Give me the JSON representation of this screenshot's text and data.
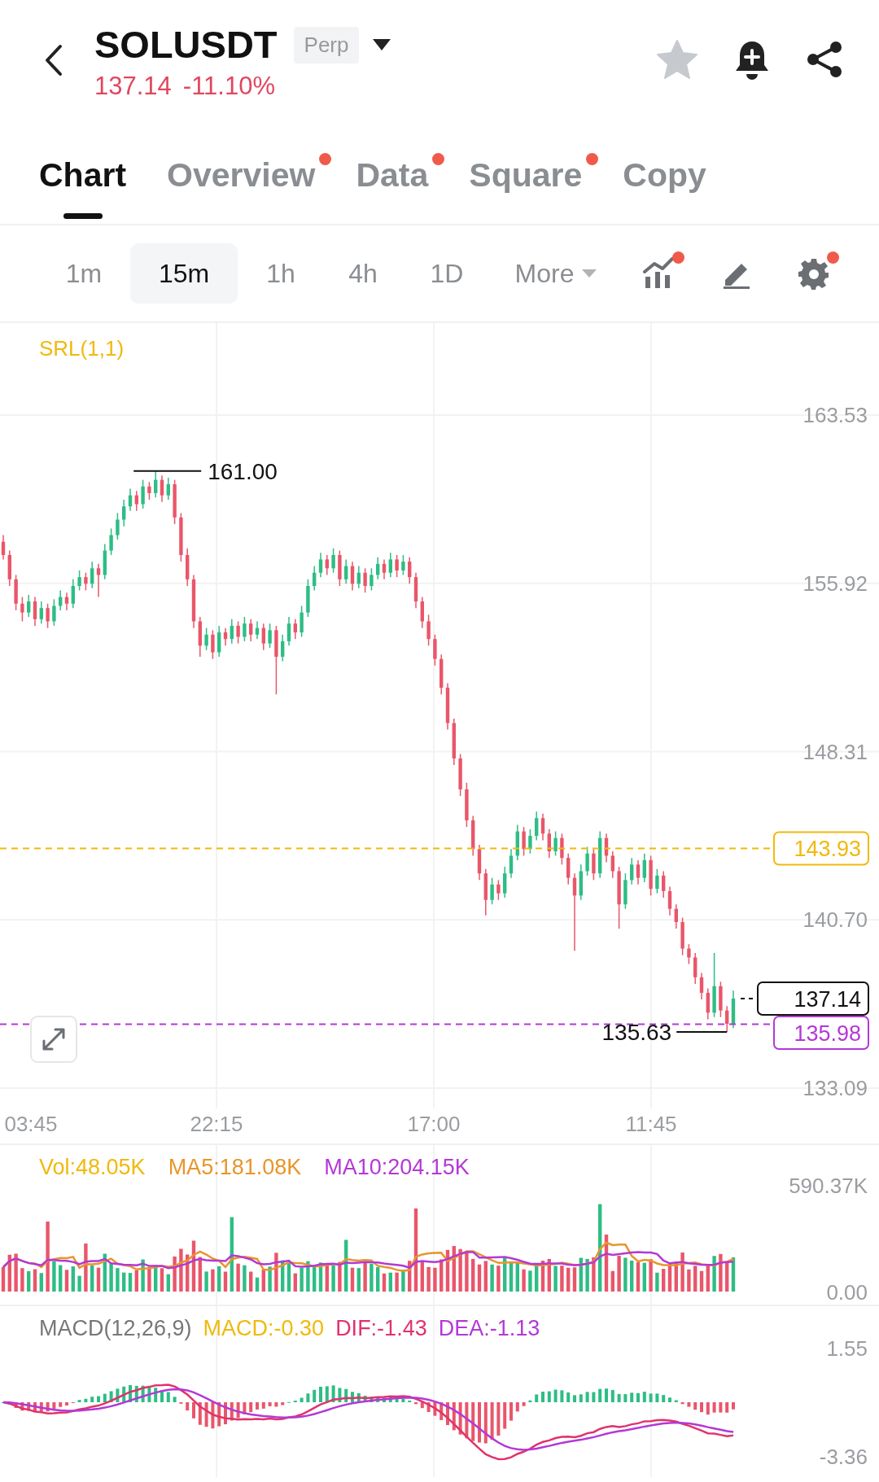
{
  "header": {
    "symbol": "SOLUSDT",
    "contract_badge": "Perp",
    "price": "137.14",
    "change": "-11.10%"
  },
  "tabs": [
    {
      "label": "Chart",
      "selected": true,
      "dot": false
    },
    {
      "label": "Overview",
      "selected": false,
      "dot": true
    },
    {
      "label": "Data",
      "selected": false,
      "dot": true
    },
    {
      "label": "Square",
      "selected": false,
      "dot": true
    },
    {
      "label": "Copy",
      "selected": false,
      "dot": false
    }
  ],
  "intervals": [
    {
      "label": "1m",
      "selected": false
    },
    {
      "label": "15m",
      "selected": true
    },
    {
      "label": "1h",
      "selected": false
    },
    {
      "label": "4h",
      "selected": false
    },
    {
      "label": "1D",
      "selected": false
    }
  ],
  "more": "More",
  "tools": [
    {
      "kind": "indicator",
      "dot": true
    },
    {
      "kind": "draw",
      "dot": false
    },
    {
      "kind": "settings",
      "dot": true
    }
  ],
  "main_chart": {
    "indicator": "SRL(1,1)",
    "high_label": "161.00",
    "low_label": "135.63",
    "last_price": "137.14",
    "time_axis": [
      "03:45",
      "22:15",
      "17:00",
      "11:45"
    ],
    "chart_data": {
      "type": "candlestick",
      "grid": true,
      "ref_lines": [
        {
          "axis": "y",
          "value": 143.93,
          "label": "143.93",
          "color": "#f0b90b"
        },
        {
          "axis": "y",
          "value": 135.98,
          "label": "135.98",
          "color": "#b438d6"
        }
      ],
      "yticks": [
        {
          "value": 163.53,
          "label": "163.53"
        },
        {
          "value": 155.92,
          "label": "155.92"
        },
        {
          "value": 148.31,
          "label": "148.31"
        },
        {
          "value": 140.7,
          "label": "140.70"
        },
        {
          "value": 133.09,
          "label": "133.09"
        }
      ],
      "ylim": [
        133.09,
        163.53
      ],
      "ohlc": [
        [
          157.8,
          158.1,
          157.0,
          157.2
        ],
        [
          157.2,
          157.4,
          155.8,
          156.1
        ],
        [
          156.1,
          156.3,
          154.7,
          155.0
        ],
        [
          155.0,
          155.3,
          154.2,
          154.6
        ],
        [
          154.6,
          155.4,
          154.4,
          155.1
        ],
        [
          155.1,
          155.3,
          154.0,
          154.3
        ],
        [
          154.3,
          155.1,
          154.1,
          154.8
        ],
        [
          154.8,
          155.0,
          153.9,
          154.2
        ],
        [
          154.2,
          155.2,
          154.0,
          154.9
        ],
        [
          154.9,
          155.6,
          154.7,
          155.3
        ],
        [
          155.3,
          155.5,
          154.7,
          155.0
        ],
        [
          155.0,
          156.1,
          154.8,
          155.8
        ],
        [
          155.8,
          156.5,
          155.6,
          156.2
        ],
        [
          156.2,
          156.4,
          155.6,
          155.9
        ],
        [
          155.9,
          156.9,
          155.7,
          156.6
        ],
        [
          156.6,
          156.8,
          155.3,
          156.3
        ],
        [
          156.3,
          157.7,
          156.1,
          157.4
        ],
        [
          157.4,
          158.4,
          157.2,
          158.1
        ],
        [
          158.1,
          159.1,
          157.9,
          158.8
        ],
        [
          158.8,
          159.7,
          158.5,
          159.4
        ],
        [
          159.4,
          160.2,
          159.2,
          159.9
        ],
        [
          159.9,
          160.1,
          159.2,
          159.5
        ],
        [
          159.5,
          160.6,
          159.3,
          160.3
        ],
        [
          160.3,
          160.5,
          159.7,
          160.0
        ],
        [
          160.0,
          161.0,
          159.8,
          160.6
        ],
        [
          160.6,
          160.8,
          159.6,
          159.9
        ],
        [
          159.9,
          160.7,
          159.7,
          160.4
        ],
        [
          160.4,
          160.6,
          158.6,
          158.9
        ],
        [
          158.9,
          159.1,
          156.9,
          157.2
        ],
        [
          157.2,
          157.5,
          155.8,
          156.1
        ],
        [
          156.1,
          156.3,
          153.9,
          154.2
        ],
        [
          154.2,
          154.4,
          152.6,
          153.1
        ],
        [
          153.1,
          153.9,
          152.9,
          153.6
        ],
        [
          153.6,
          153.8,
          152.5,
          152.8
        ],
        [
          152.8,
          154.0,
          152.6,
          153.7
        ],
        [
          153.7,
          153.9,
          153.1,
          153.4
        ],
        [
          153.4,
          154.3,
          153.2,
          154.0
        ],
        [
          154.0,
          154.2,
          153.2,
          153.5
        ],
        [
          153.5,
          154.4,
          153.3,
          154.1
        ],
        [
          154.1,
          154.3,
          153.3,
          153.6
        ],
        [
          153.6,
          154.2,
          153.4,
          153.9
        ],
        [
          153.9,
          154.1,
          152.9,
          153.2
        ],
        [
          153.2,
          154.1,
          153.0,
          153.8
        ],
        [
          153.8,
          154.0,
          150.9,
          152.6
        ],
        [
          152.6,
          153.6,
          152.4,
          153.3
        ],
        [
          153.3,
          154.4,
          153.1,
          154.1
        ],
        [
          154.1,
          154.3,
          153.4,
          153.7
        ],
        [
          153.7,
          154.9,
          153.5,
          154.6
        ],
        [
          154.6,
          156.1,
          154.4,
          155.8
        ],
        [
          155.8,
          156.7,
          155.6,
          156.4
        ],
        [
          156.4,
          157.3,
          156.2,
          157.0
        ],
        [
          157.0,
          157.2,
          156.3,
          156.6
        ],
        [
          156.6,
          157.5,
          156.4,
          157.2
        ],
        [
          157.2,
          157.4,
          155.8,
          156.1
        ],
        [
          156.1,
          157.0,
          155.9,
          156.7
        ],
        [
          156.7,
          156.9,
          155.6,
          155.9
        ],
        [
          155.9,
          156.7,
          155.7,
          156.4
        ],
        [
          156.4,
          156.6,
          155.5,
          155.8
        ],
        [
          155.8,
          156.6,
          155.6,
          156.3
        ],
        [
          156.3,
          157.1,
          156.1,
          156.8
        ],
        [
          156.8,
          157.0,
          156.1,
          156.4
        ],
        [
          156.4,
          157.3,
          156.2,
          157.0
        ],
        [
          157.0,
          157.2,
          156.2,
          156.5
        ],
        [
          156.5,
          157.2,
          156.3,
          156.9
        ],
        [
          156.9,
          157.1,
          155.9,
          156.2
        ],
        [
          156.2,
          156.4,
          154.8,
          155.1
        ],
        [
          155.1,
          155.3,
          153.9,
          154.2
        ],
        [
          154.2,
          154.5,
          153.1,
          153.4
        ],
        [
          153.4,
          153.6,
          152.2,
          152.5
        ],
        [
          152.5,
          152.7,
          150.9,
          151.2
        ],
        [
          151.2,
          151.4,
          149.3,
          149.6
        ],
        [
          149.6,
          149.8,
          147.7,
          148.0
        ],
        [
          148.0,
          148.2,
          146.3,
          146.6
        ],
        [
          146.6,
          146.9,
          144.9,
          145.2
        ],
        [
          145.2,
          145.4,
          143.6,
          143.9
        ],
        [
          143.9,
          144.1,
          142.5,
          142.8
        ],
        [
          142.8,
          143.0,
          140.9,
          141.6
        ],
        [
          141.6,
          142.6,
          141.4,
          142.3
        ],
        [
          142.3,
          142.5,
          141.6,
          141.9
        ],
        [
          141.9,
          143.1,
          141.7,
          142.8
        ],
        [
          142.8,
          143.9,
          142.6,
          143.6
        ],
        [
          143.6,
          145.0,
          143.4,
          144.7
        ],
        [
          144.7,
          144.9,
          143.6,
          143.9
        ],
        [
          143.9,
          144.8,
          143.7,
          144.5
        ],
        [
          144.5,
          145.6,
          144.3,
          145.3
        ],
        [
          145.3,
          145.5,
          144.3,
          144.6
        ],
        [
          144.6,
          144.8,
          143.5,
          143.8
        ],
        [
          143.8,
          144.7,
          143.6,
          144.4
        ],
        [
          144.4,
          144.6,
          143.2,
          143.5
        ],
        [
          143.5,
          143.7,
          142.3,
          142.6
        ],
        [
          142.6,
          142.8,
          139.3,
          141.8
        ],
        [
          141.8,
          143.2,
          141.6,
          142.9
        ],
        [
          142.9,
          144.0,
          142.7,
          143.7
        ],
        [
          143.7,
          143.9,
          142.5,
          142.8
        ],
        [
          142.8,
          144.7,
          142.6,
          144.4
        ],
        [
          144.4,
          144.6,
          143.3,
          143.6
        ],
        [
          143.6,
          143.8,
          142.6,
          142.9
        ],
        [
          142.9,
          143.1,
          140.3,
          141.4
        ],
        [
          141.4,
          142.8,
          141.2,
          142.5
        ],
        [
          142.5,
          143.5,
          142.3,
          143.2
        ],
        [
          143.2,
          143.4,
          142.3,
          142.6
        ],
        [
          142.6,
          143.7,
          142.4,
          143.4
        ],
        [
          143.4,
          143.6,
          141.8,
          142.1
        ],
        [
          142.1,
          143.0,
          141.9,
          142.7
        ],
        [
          142.7,
          142.9,
          141.7,
          142.0
        ],
        [
          142.0,
          142.2,
          140.9,
          141.2
        ],
        [
          141.2,
          141.4,
          140.3,
          140.6
        ],
        [
          140.6,
          140.8,
          139.1,
          139.4
        ],
        [
          139.4,
          139.6,
          138.7,
          139.0
        ],
        [
          139.0,
          139.2,
          137.8,
          138.1
        ],
        [
          138.1,
          138.3,
          137.1,
          137.4
        ],
        [
          137.4,
          137.6,
          136.2,
          136.5
        ],
        [
          136.5,
          139.2,
          136.3,
          137.7
        ],
        [
          137.7,
          137.9,
          136.3,
          136.6
        ],
        [
          136.6,
          136.8,
          135.63,
          136.0
        ],
        [
          136.0,
          137.5,
          135.8,
          137.14
        ]
      ]
    }
  },
  "volume": {
    "legend": [
      {
        "text": "Vol:48.05K",
        "color": "#f0b90b"
      },
      {
        "text": "MA5:181.08K",
        "color": "#e8952a"
      },
      {
        "text": "MA10:204.15K",
        "color": "#b438d6"
      }
    ],
    "axis": [
      "590.37K",
      "0.00"
    ]
  },
  "macd": {
    "legend": [
      {
        "text": "MACD(12,26,9)",
        "color": "#777777"
      },
      {
        "text": "MACD:-0.30",
        "color": "#f0b90b"
      },
      {
        "text": "DIF:-1.43",
        "color": "#e0336b"
      },
      {
        "text": "DEA:-1.13",
        "color": "#b438d6"
      }
    ],
    "axis": [
      "1.55",
      "-3.36"
    ]
  }
}
